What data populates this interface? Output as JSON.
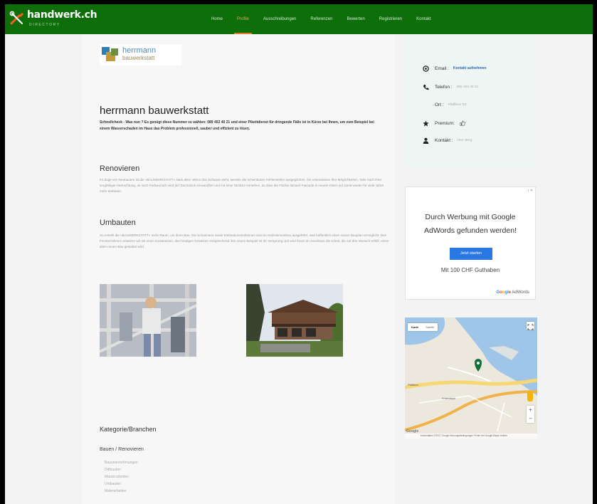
{
  "site": {
    "logo_text": "handwerk.ch",
    "logo_sub": "DIRECTORY"
  },
  "nav": {
    "items": [
      {
        "label": "Home",
        "active": false
      },
      {
        "label": "Profile",
        "active": true
      },
      {
        "label": "Ausschreibungen",
        "active": false
      },
      {
        "label": "Referenzen",
        "active": false
      },
      {
        "label": "Bewerten",
        "active": false
      },
      {
        "label": "Registrieren",
        "active": false
      },
      {
        "label": "Kontakt",
        "active": false
      }
    ]
  },
  "company": {
    "logo_line1": "herrmann",
    "logo_line2": "bauwerkstatt",
    "name": "herrmann bauwerkstatt",
    "intro": "Schnellcheck - Was nun ? Es genügt diese Nummer zu wählen: 089 453 40 21 und einer Pikettdienst für dringende Fälle ist in Kürze bei Ihnen, um zum Beispiel bei einem Wasserschaden im Haus das Problem professionell, sauber und effizient zu lösen."
  },
  "sections": [
    {
      "title": "Renovieren",
      "text": "Im Zuge von Neubauten ist die «BAUWERKSTATT» stark aktiv. Wenn das Zuhause steht, werden die scheinbaren Fehlerstellen ausgeglichen. Sie unterstützen Ihre Möglichkeiten, Teile nach ihrer sorgfältigen Betrachtung. Je nach Farbwunsch wird der Dachstock einwandfrei und mit einer Struktur versehen, so dass die Fläche danach Fassade in neuem Kleid und somit wieder für viele Jahre mehr darbietet."
    },
    {
      "title": "Umbauten",
      "text": "So erstellt die «BAUWERKSTATT» mehr Raum, um ihren Bau. Die Schreinerei sowie Einbaukonstruktionen wird im Holzelementbau ausgeführt, was hoffentlich einen neuen Bauplan ermöglicht. Den Fensterrahmen ersetzen wir mit einer Konstruktion, den heutigen Gesetzen entsprechend. Ein neues Beispiel ist Ihr Vorsprung und wird Ihnen im Anschluss die Arbeit, die auf den Wunsch erfüllt, einen alten neuen Bau gestaltet wird."
    }
  ],
  "categories": {
    "title": "Kategorie/Branchen",
    "subtitle": "Bauen / Renovieren",
    "items": [
      "Bauunternehmungen",
      "Dittbauten",
      "Maurerarbeiten",
      "Umbauten",
      "Malerarbeiten"
    ]
  },
  "contact": {
    "email_label": "Email :",
    "email_link": "Kontakt aufnehmen",
    "phone_label": "Telefon :",
    "phone_value": "089 453 40 21",
    "city_label": "Ort :",
    "city_value": "Pfäffikon SZ",
    "premium_label": "Premium:",
    "contact_label": "Kontakt :",
    "contact_value": "Herr Berg"
  },
  "ad": {
    "close": "i ✕",
    "line1": "Durch Werbung mit Google",
    "line2": "AdWords gefunden werden!",
    "button": "Jetzt starten",
    "credit": "Mit 100 CHF Guthaben",
    "brand": "Google",
    "brand_product": "AdWords"
  },
  "map": {
    "tab_map": "Karte",
    "tab_satellite": "Satellit",
    "label_a": "Pfäffikon",
    "label_b": "Freienbach",
    "footer": "Kartendaten ©2017 Google  Nutzungsbedingungen  Fehler bei Google Maps melden",
    "google": "Google",
    "zoom_in": "+",
    "zoom_out": "−"
  }
}
